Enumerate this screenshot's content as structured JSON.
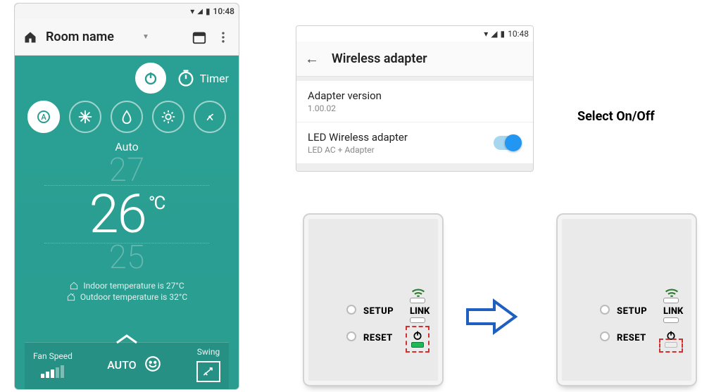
{
  "statusbar": {
    "time": "10:48"
  },
  "ac_app": {
    "title": "Room name",
    "timer_label": "Timer",
    "mode_label": "Auto",
    "temp_above": "27",
    "temp_main": "26",
    "temp_unit": "°C",
    "temp_below": "25",
    "indoor_line": "Indoor temperature is  27°C",
    "outdoor_line": "Outdoor temperature is  32°C",
    "fanspeed_label": "Fan Speed",
    "fanspeed_value": "AUTO",
    "swing_label": "Swing"
  },
  "wifi_app": {
    "title": "Wireless adapter",
    "row1_title": "Adapter version",
    "row1_value": "1.00.02",
    "row2_title": "LED Wireless adapter",
    "row2_sub": "LED AC + Adapter"
  },
  "callout": "Select On/Off",
  "device": {
    "setup": "SETUP",
    "reset": "RESET",
    "link": "LINK"
  }
}
